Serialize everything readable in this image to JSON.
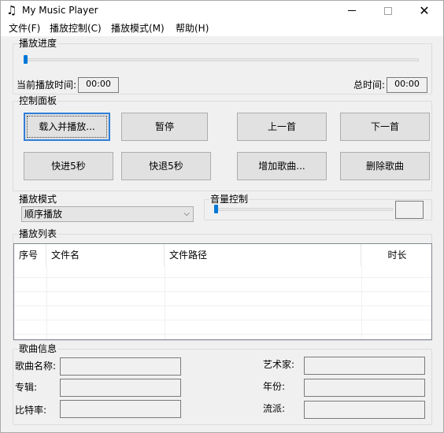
{
  "window": {
    "title": "My Music Player",
    "icon": "music-note-icon"
  },
  "menu": {
    "items": [
      "文件(F)",
      "播放控制(C)",
      "播放模式(M)",
      "帮助(H)"
    ]
  },
  "progress": {
    "group_label": "播放进度",
    "position_fraction": 0,
    "current_label": "当前播放时间:",
    "current_value": "00:00",
    "total_label": "总时间:",
    "total_value": "00:00"
  },
  "controls": {
    "group_label": "控制面板",
    "buttons": {
      "load_play": "载入并播放...",
      "pause": "暂停",
      "prev": "上一首",
      "next": "下一首",
      "forward": "快进5秒",
      "rewind": "快退5秒",
      "add_song": "增加歌曲...",
      "delete_song": "删除歌曲"
    }
  },
  "mode": {
    "group_label": "播放模式",
    "selected": "顺序播放"
  },
  "volume": {
    "group_label": "音量控制",
    "level_fraction": 0,
    "value_text": ""
  },
  "playlist": {
    "group_label": "播放列表",
    "columns": [
      "序号",
      "文件名",
      "文件路径",
      "时长"
    ],
    "rows": []
  },
  "song_info": {
    "group_label": "歌曲信息",
    "fields": {
      "title_label": "歌曲名称:",
      "title_value": "",
      "album_label": "专辑:",
      "album_value": "",
      "bitrate_label": "比特率:",
      "bitrate_value": "",
      "artist_label": "艺术家:",
      "artist_value": "",
      "year_label": "年份:",
      "year_value": "",
      "genre_label": "流派:",
      "genre_value": ""
    }
  },
  "colors": {
    "accent": "#0078d7",
    "window_bg": "#f0f0f0"
  }
}
